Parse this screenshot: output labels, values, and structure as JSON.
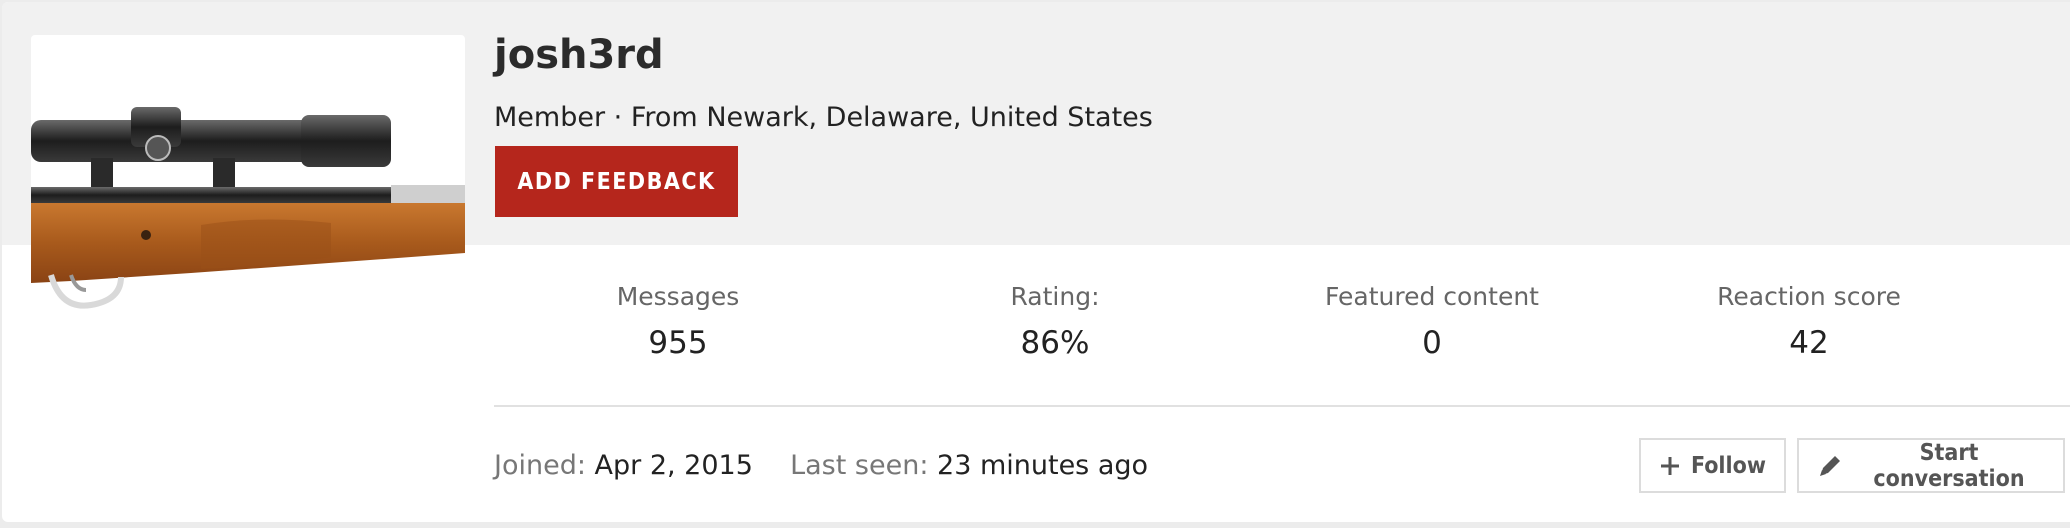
{
  "profile": {
    "username": "josh3rd",
    "role": "Member",
    "location_prefix": "· From",
    "location": "Newark, Delaware, United States",
    "avatar_icon": "rifle-with-scope-image"
  },
  "actions": {
    "add_feedback": "ADD FEEDBACK",
    "follow": "Follow",
    "start_conversation": "Start conversation"
  },
  "stats": [
    {
      "label": "Messages",
      "value": "955"
    },
    {
      "label": "Rating:",
      "value": "86%"
    },
    {
      "label": "Featured content",
      "value": "0"
    },
    {
      "label": "Reaction score",
      "value": "42"
    }
  ],
  "meta": {
    "joined_label": "Joined:",
    "joined_value": "Apr 2, 2015",
    "last_seen_label": "Last seen:",
    "last_seen_value": "23 minutes ago"
  },
  "colors": {
    "accent": "#b5261c",
    "header_bg": "#f1f1f1"
  }
}
